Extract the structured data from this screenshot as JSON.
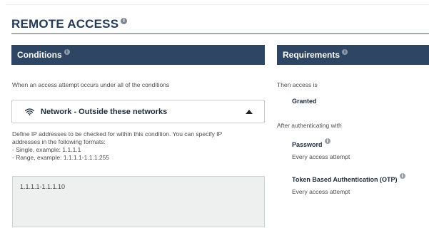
{
  "page": {
    "title": "REMOTE ACCESS"
  },
  "conditions": {
    "header": "Conditions",
    "description": "When an access attempt occurs under all of the conditions",
    "network": {
      "label": "Network - Outside these networks"
    },
    "define_lines": [
      "Define IP addresses to be checked for within this condition. You can specify IP",
      "addresses in the following formats:",
      "- Single, example: 1.1.1.1",
      "- Range, example: 1.1.1.1-1.1.1.255"
    ],
    "ip_value": "1.1.1.1-1.1.1.10"
  },
  "requirements": {
    "header": "Requirements",
    "then_text": "Then access is",
    "access_result": "Granted",
    "after_text": "After authenticating with",
    "methods": [
      {
        "name": "Password",
        "frequency": "Every access attempt"
      },
      {
        "name": "Token Based Authentication (OTP)",
        "frequency": "Every access attempt"
      }
    ]
  },
  "colors": {
    "header_bg": "#2e4563",
    "title": "#243a57"
  },
  "icons": {
    "info": "info-icon",
    "wifi": "wifi-icon",
    "chevron": "chevron-up-icon"
  }
}
